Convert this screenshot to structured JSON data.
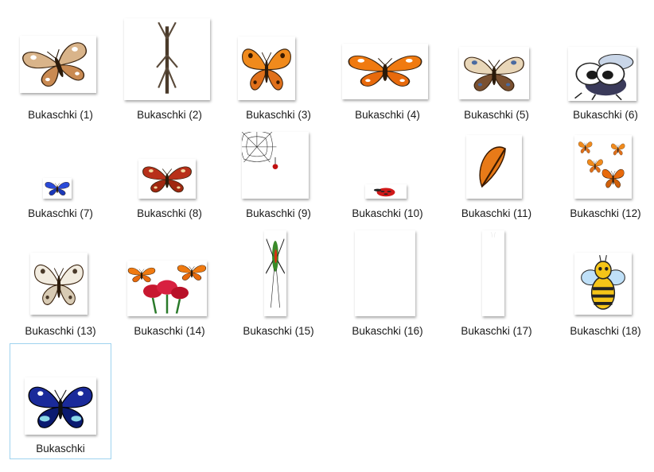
{
  "items": [
    {
      "label": "Bukaschki (1)",
      "icon": "butterfly-brown-icon",
      "selected": false
    },
    {
      "label": "Bukaschki (2)",
      "icon": "stick-insect-icon",
      "selected": false
    },
    {
      "label": "Bukaschki (3)",
      "icon": "butterfly-orange-icon",
      "selected": false
    },
    {
      "label": "Bukaschki (4)",
      "icon": "monarch-butterfly-icon",
      "selected": false
    },
    {
      "label": "Bukaschki (5)",
      "icon": "butterfly-swallowtail-icon",
      "selected": false
    },
    {
      "label": "Bukaschki (6)",
      "icon": "cartoon-fly-icon",
      "selected": false
    },
    {
      "label": "Bukaschki (7)",
      "icon": "butterfly-blue-small-icon",
      "selected": false
    },
    {
      "label": "Bukaschki (8)",
      "icon": "butterfly-checkered-icon",
      "selected": false
    },
    {
      "label": "Bukaschki (9)",
      "icon": "spider-web-icon",
      "selected": false
    },
    {
      "label": "Bukaschki (10)",
      "icon": "ladybug-icon",
      "selected": false
    },
    {
      "label": "Bukaschki (11)",
      "icon": "butterfly-side-icon",
      "selected": false
    },
    {
      "label": "Bukaschki (12)",
      "icon": "butterflies-group-icon",
      "selected": false
    },
    {
      "label": "Bukaschki (13)",
      "icon": "butterfly-white-icon",
      "selected": false
    },
    {
      "label": "Bukaschki (14)",
      "icon": "butterflies-roses-icon",
      "selected": false
    },
    {
      "label": "Bukaschki (15)",
      "icon": "spider-green-icon",
      "selected": false
    },
    {
      "label": "Bukaschki (16)",
      "icon": "blank-image-icon",
      "selected": false
    },
    {
      "label": "Bukaschki (17)",
      "icon": "blank-tall-image-icon",
      "selected": false
    },
    {
      "label": "Bukaschki (18)",
      "icon": "cartoon-bee-icon",
      "selected": false
    },
    {
      "label": "Bukaschki",
      "icon": "butterfly-blue-icon",
      "selected": true
    }
  ],
  "colors": {
    "selection_border": "#9fd3ef",
    "label_text": "#1a1a1a"
  }
}
